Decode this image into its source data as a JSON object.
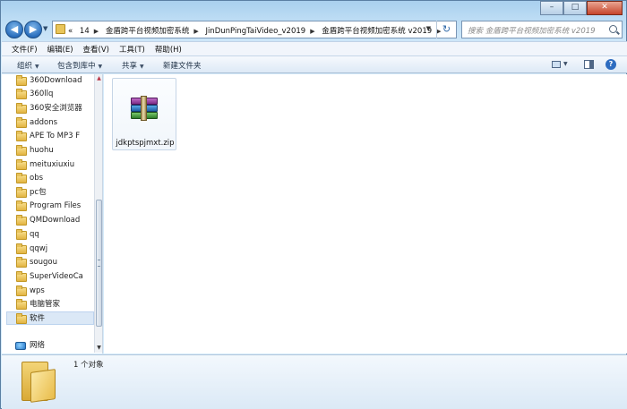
{
  "window": {
    "controls": {
      "minimize": "–",
      "maximize": "□",
      "close": "✕"
    }
  },
  "address_bar": {
    "overflow": "«",
    "crumbs": [
      "14",
      "金盾跨平台视频加密系统",
      "JinDunPingTaiVideo_v2019",
      "金盾跨平台视频加密系统 v2019"
    ],
    "search_placeholder": "搜索 金盾跨平台视频加密系统 v2019"
  },
  "menubar": [
    "文件(F)",
    "编辑(E)",
    "查看(V)",
    "工具(T)",
    "帮助(H)"
  ],
  "toolbar": {
    "organize": "组织",
    "include_in_library": "包含到库中",
    "share": "共享",
    "new_folder": "新建文件夹"
  },
  "sidebar": {
    "items": [
      "360Download",
      "360llq",
      "360安全浏览器",
      "addons",
      "APE To MP3 F",
      "huohu",
      "meituxiuxiu",
      "obs",
      "pc包",
      "Program Files",
      "QMDownload",
      "qq",
      "qqwj",
      "sougou",
      "SuperVideoCa",
      "wps",
      "电脑管家",
      "软件"
    ],
    "selected_index": 17,
    "network_label": "网络"
  },
  "files": [
    {
      "name": "jdkptspjmxt.zip",
      "icon": "winrar-archive-icon"
    }
  ],
  "details": {
    "item_count": "1 个对象"
  }
}
